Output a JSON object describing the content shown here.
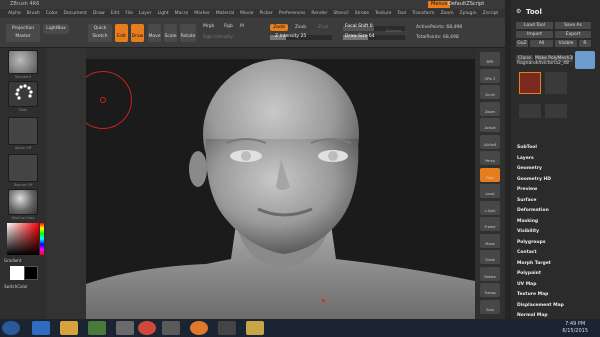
{
  "titlebar": {
    "app_title": "ZBrush 4R6",
    "menus_label": "Menus",
    "script_label": "DefaultZScript"
  },
  "menubar": [
    "Alpha",
    "Brush",
    "Color",
    "Document",
    "Draw",
    "Edit",
    "File",
    "Layer",
    "Light",
    "Macro",
    "Marker",
    "Material",
    "Movie",
    "Picker",
    "Preferences",
    "Render",
    "Stencil",
    "Stroke",
    "Texture",
    "Tool",
    "Transform",
    "Zoom",
    "Zplugin",
    "Zscript"
  ],
  "toolbar": {
    "projection_master": "Projection Master",
    "lightbox": "LightBox",
    "quick_sketch": "Quick Sketch",
    "edit": "Edit",
    "draw": "Draw",
    "move": "Move",
    "scale": "Scale",
    "rotate": "Rotate",
    "mrgb": "Mrgb",
    "rgb": "Rgb",
    "m": "M",
    "rgb_intensity": "Rgb Intensity",
    "zadd": "Zadd",
    "zsub": "Zsub",
    "zcut": "Zcut",
    "z_intensity": "Z Intensity 25",
    "focal_shift": "Focal Shift 0",
    "draw_size": "Draw Size 64",
    "active_points": "ActivePoints: 68,498",
    "total_points": "TotalPoints: 68,498",
    "dynamic": "Dynamic"
  },
  "leftbar": {
    "brush_name": "Standard",
    "stroke_name": "Dots",
    "alpha_name": "Alpha Off",
    "texture_name": "Texture Off",
    "material_name": "MatCap Gray",
    "gradient_label": "Gradient",
    "switch_color_label": "SwitchColor"
  },
  "rightshelf": [
    "BPR",
    "SPix 3",
    "Scroll",
    "Zoom",
    "Actual",
    "AAHalf",
    "Persp",
    "Floor",
    "Local",
    "L.Sym",
    "Frame",
    "Move",
    "Scale",
    "Rotate",
    "Transp",
    "Solo"
  ],
  "rightpanel": {
    "title": "Tool",
    "load_tool": "Load Tool",
    "save_as": "Save As",
    "import": "Import",
    "export": "Export",
    "goz": "GoZ",
    "all": "All",
    "visible": "Visible",
    "r": "R",
    "clone": "Clone",
    "make_polymesh": "Make PolyMesh3D",
    "current_tool": "Ragnarok4victoria2_48",
    "tool_thumbs": [
      "Ragnarok4victoria2",
      "Sphere3D",
      "SimpleBrush",
      "ZSphere",
      "PolyMesh3D",
      "Ragnarok4victoria2"
    ],
    "sections": [
      "SubTool",
      "Layers",
      "Geometry",
      "Geometry HD",
      "Preview",
      "Surface",
      "Deformation",
      "Masking",
      "Visibility",
      "Polygroups",
      "Contact",
      "Morph Target",
      "Polypaint",
      "UV Map",
      "Texture Map",
      "Displacement Map",
      "Normal Map"
    ]
  },
  "taskbar": {
    "time": "7:49 PM",
    "date": "6/15/2015"
  },
  "colors": {
    "accent": "#e87d1e",
    "panel": "#2b2b2b",
    "viewport": "#1b1b1b",
    "taskbar": "#1a2433"
  }
}
